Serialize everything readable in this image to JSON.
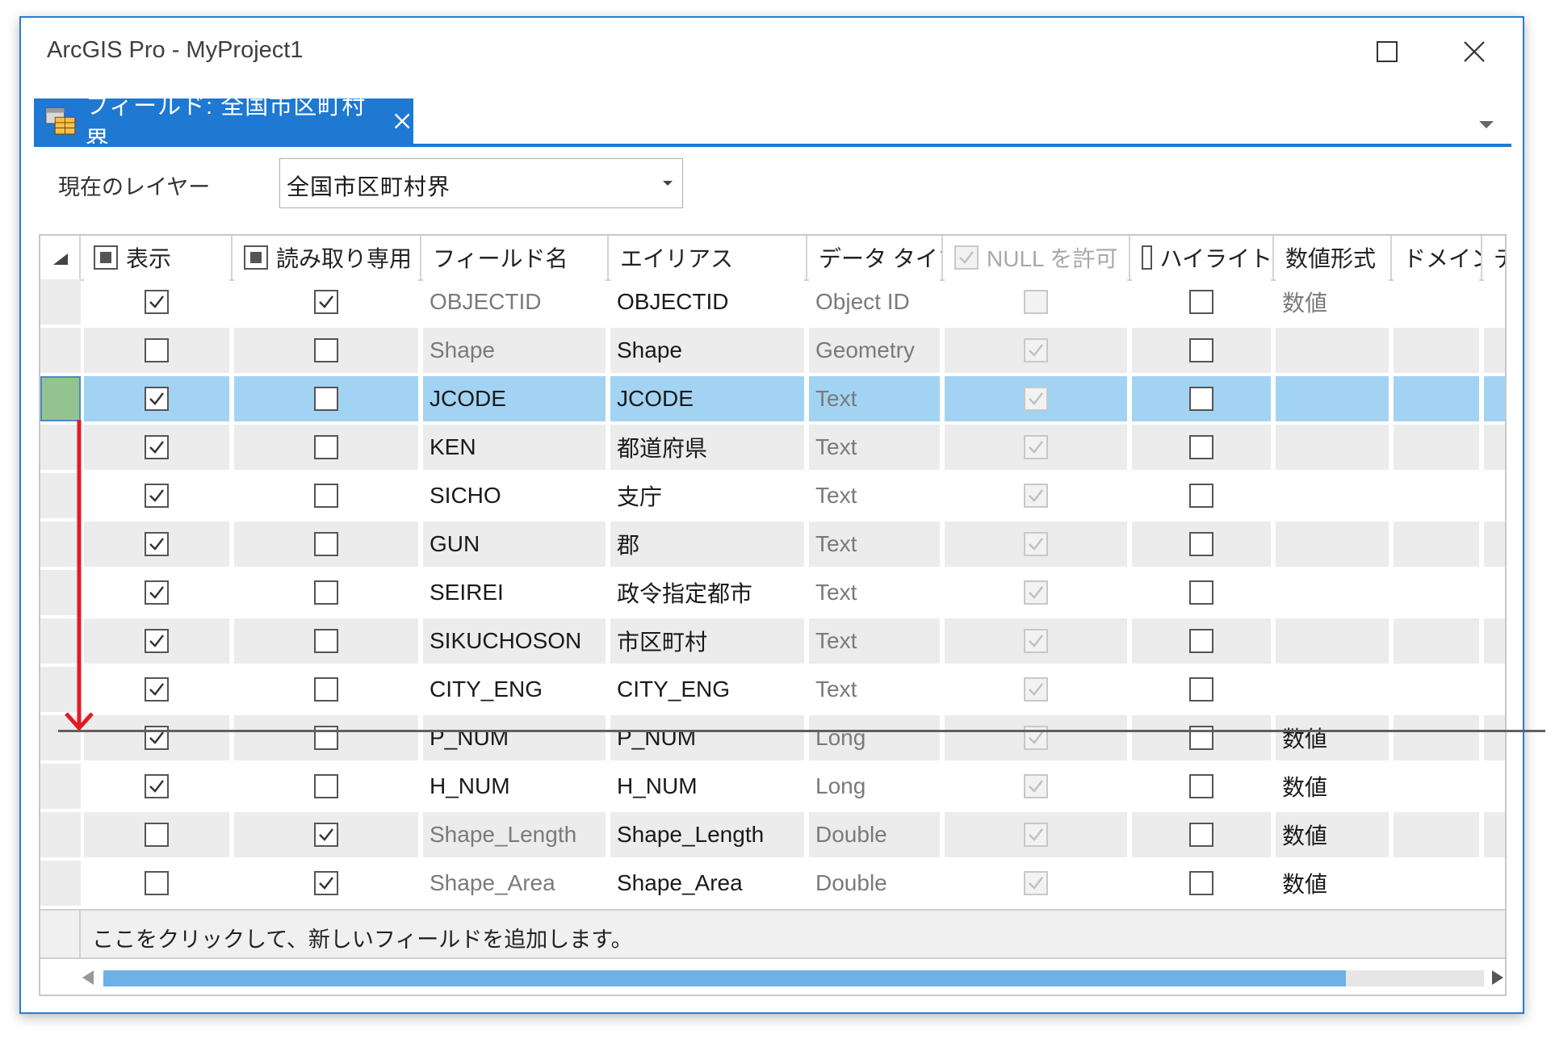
{
  "window": {
    "title": "ArcGIS Pro - MyProject1",
    "maximize_label": "Maximize",
    "close_label": "Close"
  },
  "tab": {
    "label": "フィールド:  全国市区町村界"
  },
  "layer": {
    "label": "現在のレイヤー",
    "selected": "全国市区町村界"
  },
  "columns": [
    {
      "label": "表示",
      "checkbox": "indeterminate"
    },
    {
      "label": "読み取り専用",
      "checkbox": "indeterminate"
    },
    {
      "label": "フィールド名"
    },
    {
      "label": "エイリアス"
    },
    {
      "label": "データ タイプ"
    },
    {
      "label": "NULL を許可",
      "checkbox": "checked-disabled"
    },
    {
      "label": "ハイライト",
      "checkbox": "unchecked"
    },
    {
      "label": "数値形式"
    },
    {
      "label": "ドメイン"
    },
    {
      "label": "デフ"
    }
  ],
  "rows": [
    {
      "visible": true,
      "readonly": true,
      "name": "OBJECTID",
      "alias": "OBJECTID",
      "type": "Object ID",
      "null_allowed": false,
      "highlight": false,
      "number_format": "数値",
      "name_gray": true,
      "selected": false
    },
    {
      "visible": false,
      "readonly": false,
      "name": "Shape",
      "alias": "Shape",
      "type": "Geometry",
      "null_allowed": true,
      "highlight": false,
      "number_format": "",
      "name_gray": true,
      "selected": false
    },
    {
      "visible": true,
      "readonly": false,
      "name": "JCODE",
      "alias": "JCODE",
      "type": "Text",
      "null_allowed": true,
      "highlight": false,
      "number_format": "",
      "name_gray": false,
      "selected": true
    },
    {
      "visible": true,
      "readonly": false,
      "name": "KEN",
      "alias": "都道府県",
      "type": "Text",
      "null_allowed": true,
      "highlight": false,
      "number_format": "",
      "name_gray": false,
      "selected": false
    },
    {
      "visible": true,
      "readonly": false,
      "name": "SICHO",
      "alias": "支庁",
      "type": "Text",
      "null_allowed": true,
      "highlight": false,
      "number_format": "",
      "name_gray": false,
      "selected": false
    },
    {
      "visible": true,
      "readonly": false,
      "name": "GUN",
      "alias": "郡",
      "type": "Text",
      "null_allowed": true,
      "highlight": false,
      "number_format": "",
      "name_gray": false,
      "selected": false
    },
    {
      "visible": true,
      "readonly": false,
      "name": "SEIREI",
      "alias": "政令指定都市",
      "type": "Text",
      "null_allowed": true,
      "highlight": false,
      "number_format": "",
      "name_gray": false,
      "selected": false
    },
    {
      "visible": true,
      "readonly": false,
      "name": "SIKUCHOSON",
      "alias": "市区町村",
      "type": "Text",
      "null_allowed": true,
      "highlight": false,
      "number_format": "",
      "name_gray": false,
      "selected": false
    },
    {
      "visible": true,
      "readonly": false,
      "name": "CITY_ENG",
      "alias": "CITY_ENG",
      "type": "Text",
      "null_allowed": true,
      "highlight": false,
      "number_format": "",
      "name_gray": false,
      "selected": false
    },
    {
      "visible": true,
      "readonly": false,
      "name": "P_NUM",
      "alias": "P_NUM",
      "type": "Long",
      "null_allowed": true,
      "highlight": false,
      "number_format": "数値",
      "name_gray": false,
      "selected": false
    },
    {
      "visible": true,
      "readonly": false,
      "name": "H_NUM",
      "alias": "H_NUM",
      "type": "Long",
      "null_allowed": true,
      "highlight": false,
      "number_format": "数値",
      "name_gray": false,
      "selected": false
    },
    {
      "visible": false,
      "readonly": true,
      "name": "Shape_Length",
      "alias": "Shape_Length",
      "type": "Double",
      "null_allowed": true,
      "highlight": false,
      "number_format": "数値",
      "name_gray": true,
      "selected": false
    },
    {
      "visible": false,
      "readonly": true,
      "name": "Shape_Area",
      "alias": "Shape_Area",
      "type": "Double",
      "null_allowed": true,
      "highlight": false,
      "number_format": "数値",
      "name_gray": true,
      "selected": false
    }
  ],
  "add_field_text": "ここをクリックして、新しいフィールドを追加します。",
  "scrollbar": {
    "position_fraction": 0.0,
    "visible_fraction": 0.9
  },
  "colors": {
    "accent": "#1f78d1",
    "selection": "#a3d3f3",
    "row_selected_header": "#93c48f",
    "drag_arrow": "#e21b23",
    "scroll_thumb": "#6db1e6"
  },
  "icons": {
    "tab": "field-table-icon",
    "tab_close": "close-icon",
    "window_close": "close-icon",
    "window_maximize": "maximize-icon",
    "drag": "down-arrow-icon"
  }
}
